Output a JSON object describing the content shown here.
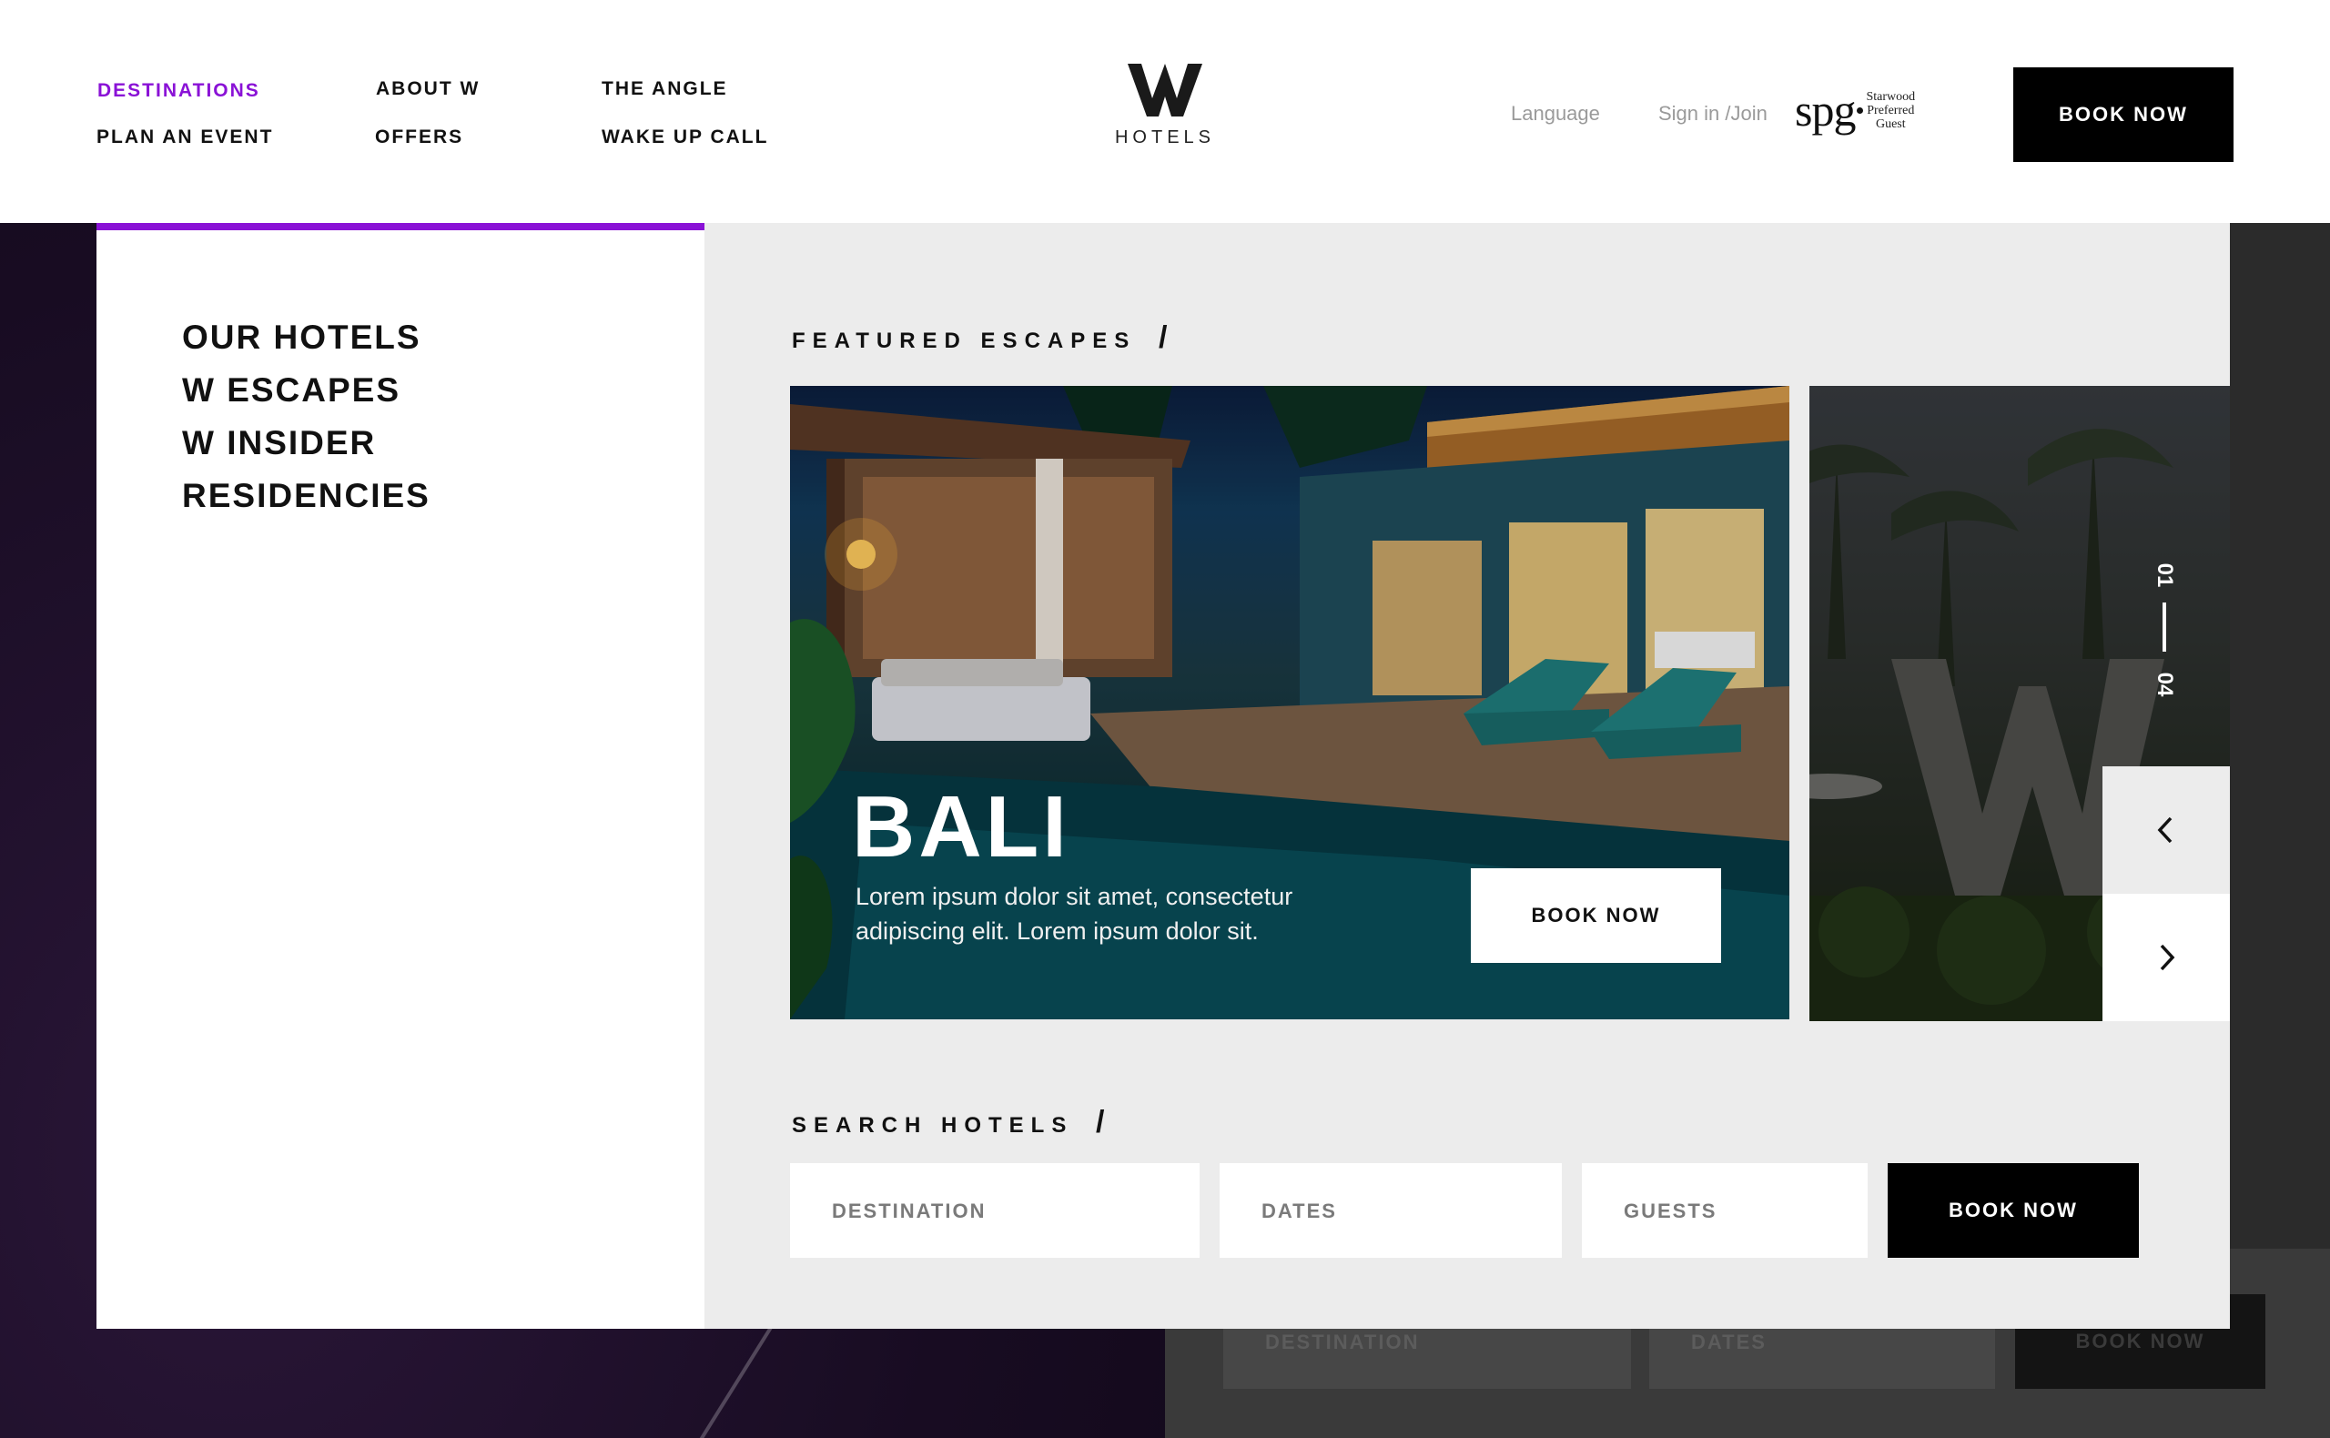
{
  "header": {
    "nav_col1": [
      "DESTINATIONS",
      "PLAN AN EVENT"
    ],
    "nav_col2": [
      "ABOUT W",
      "OFFERS"
    ],
    "nav_col3": [
      "THE ANGLE",
      "WAKE UP CALL"
    ],
    "active_nav": "DESTINATIONS",
    "logo_text": "HOTELS",
    "language_label": "Language",
    "signin_label": "Sign in /Join",
    "spg": {
      "mark": "spg",
      "line1": "Starwood",
      "line2": "Preferred",
      "line3": "Guest"
    },
    "book_now_label": "BOOK NOW"
  },
  "side_menu": [
    "OUR HOTELS",
    "W ESCAPES",
    "W INSIDER",
    "RESIDENCIES"
  ],
  "featured": {
    "section_title": "FEATURED ESCAPES",
    "card": {
      "title": "BALI",
      "description": "Lorem ipsum dolor sit amet, consectetur adipiscing elit.  Lorem ipsum dolor sit.",
      "button_label": "BOOK NOW"
    },
    "counter_current": "01",
    "counter_total": "04"
  },
  "search": {
    "section_title": "SEARCH HOTELS",
    "destination_placeholder": "DESTINATION",
    "dates_placeholder": "DATES",
    "guests_placeholder": "GUESTS",
    "button_label": "BOOK NOW"
  },
  "background_form": {
    "destination_placeholder": "DESTINATION",
    "dates_placeholder": "DATES",
    "button_label": "BOOK NOW"
  },
  "colors": {
    "accent": "#8a12d6",
    "black": "#000000",
    "panel_gray": "#ececec"
  },
  "icons": [
    "w-logo-icon",
    "chevron-left-icon",
    "chevron-right-icon"
  ]
}
